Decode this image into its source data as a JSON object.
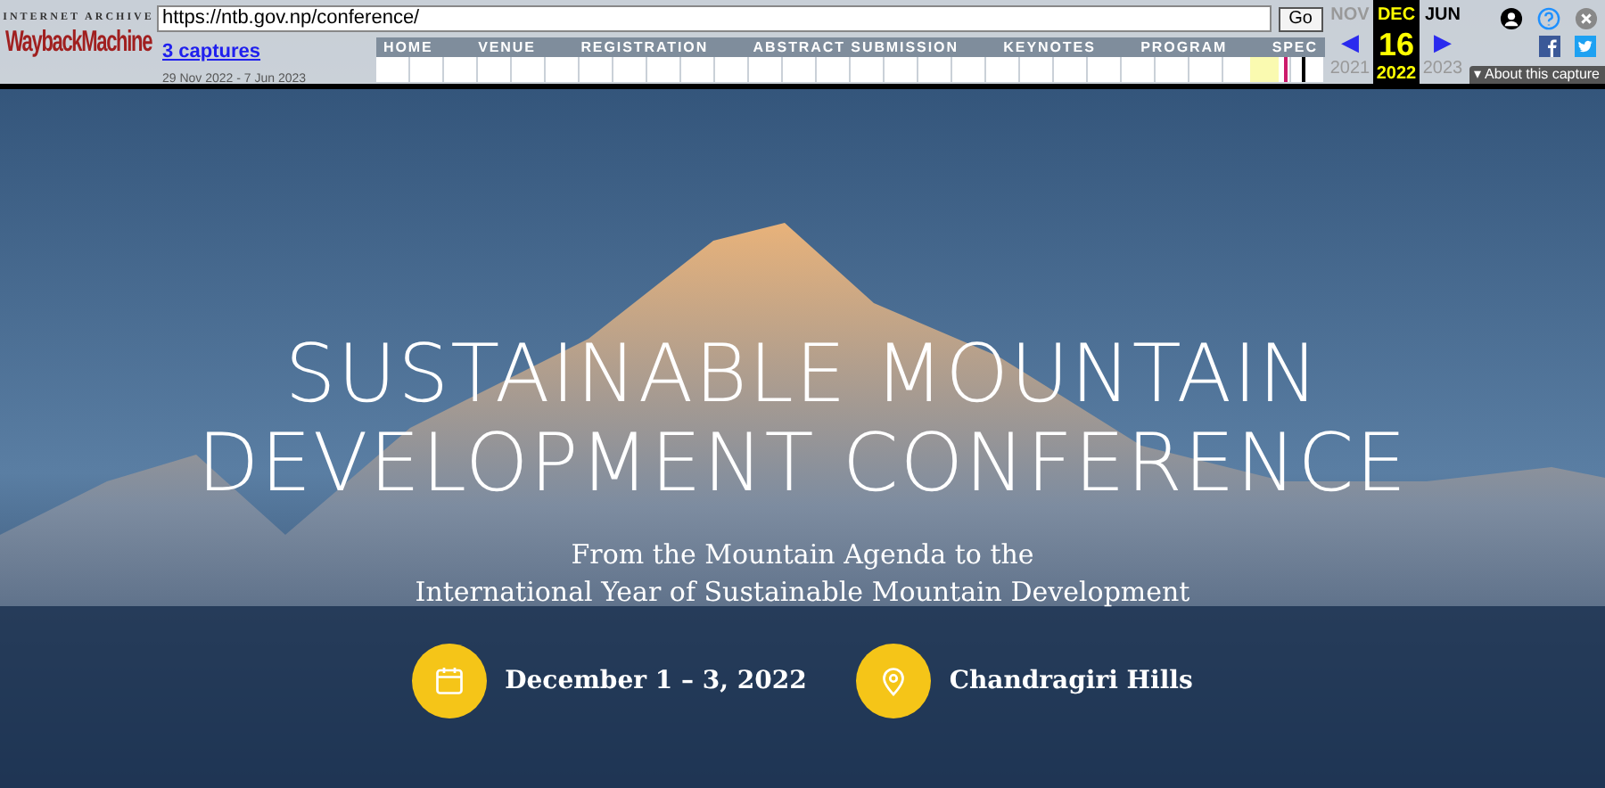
{
  "wayback": {
    "logo_top": "INTERNET ARCHIVE",
    "logo_main": "WaybackMachine",
    "url": "https://ntb.gov.np/conference/",
    "go": "Go",
    "captures_link": "3 captures",
    "captures_range": "29 Nov 2022 - 7 Jun 2023",
    "months": [
      {
        "month": "NOV",
        "arrow": "◀",
        "year": "2021",
        "selected": false
      },
      {
        "month": "DEC",
        "day": "16",
        "year": "2022",
        "selected": true
      },
      {
        "month": "JUN",
        "arrow": "▶",
        "year": "2023",
        "selected": false
      }
    ],
    "about_caret": "▾",
    "about": "About this capture"
  },
  "nav": [
    "HOME",
    "VENUE",
    "REGISTRATION",
    "ABSTRACT SUBMISSION",
    "KEYNOTES",
    "PROGRAM",
    "SPEC"
  ],
  "hero": {
    "title": "SUSTAINABLE MOUNTAIN DEVELOPMENT CONFERENCE",
    "subtitle_lines": [
      "From the Mountain Agenda to the",
      "International Year of Sustainable Mountain Development"
    ],
    "details": [
      {
        "kind": "date",
        "text": "December 1 – 3, 2022"
      },
      {
        "kind": "place",
        "text": "Chandragiri Hills"
      }
    ]
  }
}
